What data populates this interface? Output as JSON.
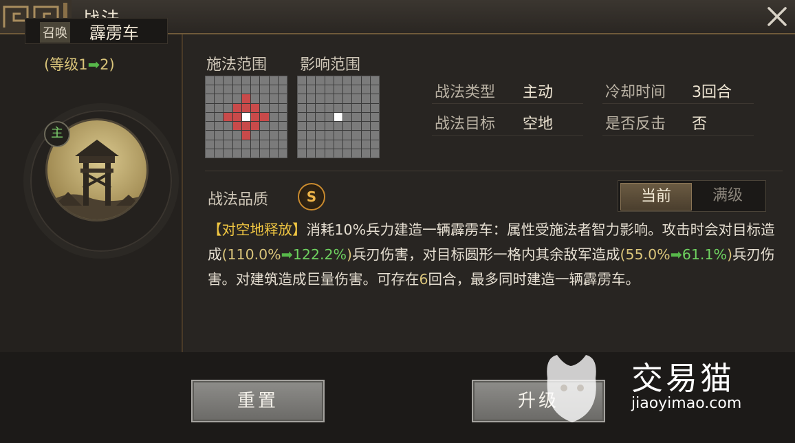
{
  "window": {
    "title": "战法"
  },
  "skill": {
    "summon_tag": "召唤",
    "name": "霹雳车",
    "level_prefix": "(等级1",
    "level_arrow": "➡",
    "level_suffix": "2)",
    "main_badge": "主"
  },
  "ranges": {
    "cast_label": "施法范围",
    "effect_label": "影响范围",
    "cast_grid": [
      "000000000",
      "000000000",
      "000010000",
      "000111000",
      "0011W1100",
      "000111000",
      "000010000",
      "000000000",
      "000000000"
    ],
    "effect_grid": [
      "000000000",
      "000000000",
      "000000000",
      "000000000",
      "0000W0000",
      "000000000",
      "000000000",
      "000000000",
      "000000000"
    ]
  },
  "info": {
    "type_label": "战法类型",
    "type_value": "主动",
    "cooldown_label": "冷却时间",
    "cooldown_value": "3回合",
    "target_label": "战法目标",
    "target_value": "空地",
    "counter_label": "是否反击",
    "counter_value": "否"
  },
  "quality": {
    "label": "战法品质",
    "grade": "S"
  },
  "toggle": {
    "current": "当前",
    "max": "满级"
  },
  "description": {
    "tag": "【对空地释放】",
    "p1": "消耗10%兵力建造一辆霹雳车：属性受施法者智力影响。攻击时会对目标造成",
    "v1_open": "(",
    "v1_from": "110.0%",
    "v1_arrow": "➡",
    "v1_to": "122.2%",
    "v1_close": ")",
    "p2": "兵刃伤害，对目标圆形一格内其余敌军造成",
    "v2_open": "(",
    "v2_from": "55.0%",
    "v2_arrow": "➡",
    "v2_to": "61.1%",
    "v2_close": ")",
    "p3": "兵刃伤害。对建筑造成巨量伤害。可存在",
    "v3": "6",
    "p4": "回合，最多同时建造一辆霹雳车。"
  },
  "buttons": {
    "reset": "重置",
    "upgrade": "升级"
  },
  "watermark": {
    "name": "交易猫",
    "url": "jiaoyimao.com"
  }
}
